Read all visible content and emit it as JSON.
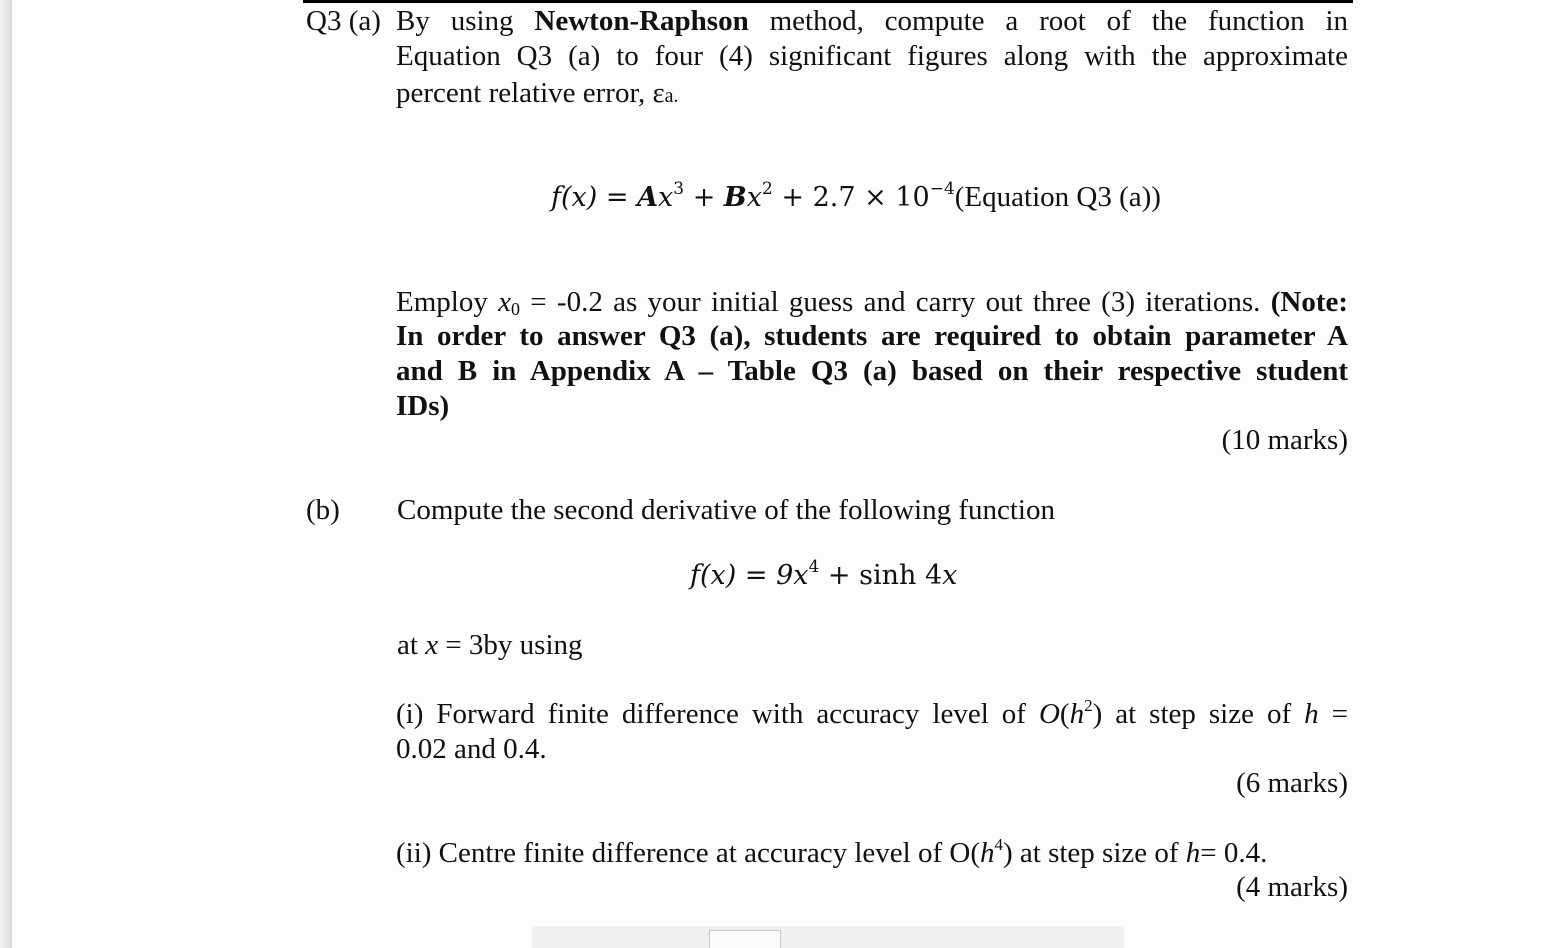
{
  "question": {
    "label": "Q3 (a)",
    "part_a": {
      "intro_prefix": "By using",
      "method_name": "Newton-Raphson",
      "intro_line1_rest": "method, compute a root of the function in",
      "intro_line2": "Equation Q3 (a) to four (4) significant figures along with the approximate",
      "intro_line3": "percent relative error, ε",
      "intro_line3_sub": "a.",
      "equation": {
        "lhs": "f(x) =",
        "A": "A",
        "x1": "x",
        "exp1": "3",
        "plus1": "+",
        "B": "B",
        "x2": "x",
        "exp2": "2",
        "plus2": "+ 2.7 × 10",
        "exp3": "−4",
        "tag": "(Equation Q3 (a))"
      },
      "employ_prefix": "Employ",
      "employ_var": "x",
      "employ_sub": "0",
      "employ_rest": "= -0.2 as your initial guess and carry out three (3) iterations.",
      "note_start": "(Note:",
      "note_line2": "In order to answer Q3 (a), students are required to obtain parameter A",
      "note_line3": "and B in Appendix A – Table Q3 (a) based on their respective student",
      "note_line4": "IDs)",
      "marks": "(10 marks)"
    },
    "part_b": {
      "label": "(b)",
      "intro": "Compute the second derivative of the following function",
      "equation": {
        "lhs": "f(x) = 9",
        "x": "x",
        "exp": "4",
        "rest": "+ sinh 4",
        "x2": "x"
      },
      "at_prefix": "at",
      "at_var": "x",
      "at_rest": "= 3by using",
      "part_i": {
        "line1_prefix": "(i) Forward finite difference with accuracy level of",
        "order_O": "O",
        "order_h": "h",
        "order_exp": "2",
        "line1_mid": ") at step size of",
        "h_var": "h",
        "line1_end": "=",
        "line2": "0.02 and 0.4.",
        "marks": "(6 marks)"
      },
      "part_ii": {
        "prefix": "(ii) Centre finite difference at accuracy level of O(",
        "h_var": "h",
        "exp": "4",
        "mid": ") at step size of",
        "h_var2": "h",
        "end": "= 0.4.",
        "marks": "(4 marks)"
      }
    }
  }
}
